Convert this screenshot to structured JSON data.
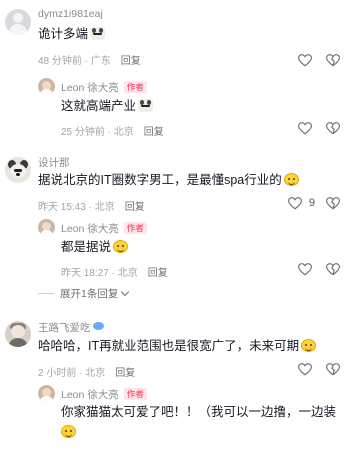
{
  "comments": [
    {
      "username": "dymz1i981eaj",
      "text": "诡计多端",
      "emoji": "dog-emoji",
      "time": "48 分钟前 · 广东",
      "reply": "回复",
      "likes": ""
    },
    {
      "username": "Leon 徐大亮",
      "author_tag": "作者",
      "text": "这就高端产业",
      "emoji": "dog-emoji",
      "time": "25 分钟前 · 北京",
      "reply": "回复",
      "likes": ""
    },
    {
      "username": "设计那",
      "text": "据说北京的IT圈数字男工，是最懂spa行业的",
      "emoji": "laugh-emoji",
      "time": "昨天 15:43 · 北京",
      "reply": "回复",
      "likes": "9"
    },
    {
      "username": "Leon 徐大亮",
      "author_tag": "作者",
      "text": "都是据说",
      "emoji": "laugh-emoji",
      "time": "昨天 18:27 · 北京",
      "reply": "回复",
      "likes": ""
    },
    {
      "expand_label": "展开1条回复"
    },
    {
      "username": "王路飞爱吃",
      "username_emoji": "fish-emoji",
      "text": "哈哈哈，IT再就业范围也是很宽广了，未来可期",
      "emoji": "smile-emoji",
      "time": "2 小时前 · 北京",
      "reply": "回复",
      "likes": ""
    },
    {
      "username": "Leon 徐大亮",
      "author_tag": "作者",
      "text": "你家猫猫太可爱了吧！！（我可以一边撸，一边装",
      "emoji": "laugh-emoji",
      "time": "",
      "reply": "",
      "likes": ""
    }
  ],
  "colors": {
    "text": "#161823",
    "meta": "#a3a4a9",
    "author_tag": "#fe2c55",
    "background": "#ffffff"
  },
  "icons": {
    "like": "heart-outline-icon",
    "dislike": "dislike-outline-icon",
    "expand": "chevron-down-icon"
  }
}
